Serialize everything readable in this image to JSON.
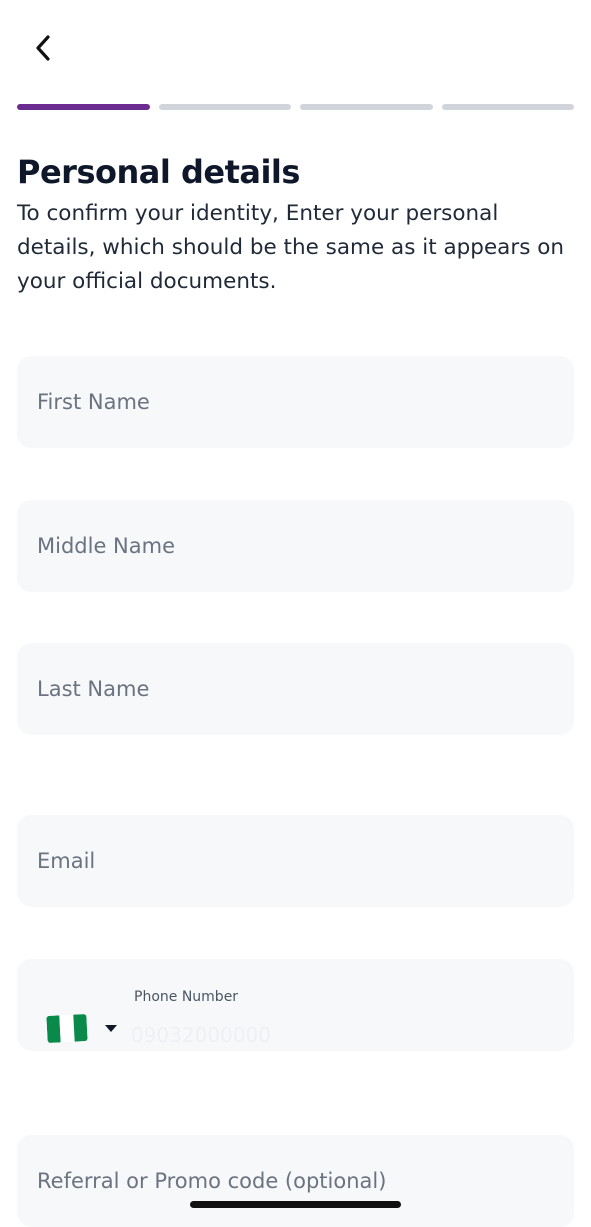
{
  "header": {
    "back_icon": "chevron-left-icon"
  },
  "progress": {
    "total_steps": 4,
    "current_step": 1,
    "active_color": "#6B2C91",
    "inactive_color": "#D1D5DB"
  },
  "page": {
    "title": "Personal details",
    "subtitle": "To confirm your identity, Enter your personal details, which should be the same as it appears on your official documents."
  },
  "form": {
    "first_name": {
      "placeholder": "First Name",
      "value": ""
    },
    "middle_name": {
      "placeholder": "Middle Name",
      "value": ""
    },
    "last_name": {
      "placeholder": "Last Name",
      "value": ""
    },
    "email": {
      "placeholder": "Email",
      "value": ""
    },
    "phone": {
      "label": "Phone Number",
      "placeholder": "09032000000",
      "value": "",
      "country_flag": "nigeria-flag-icon",
      "dropdown_icon": "caret-down-icon"
    },
    "referral": {
      "placeholder": "Referral or Promo code (optional)",
      "value": ""
    }
  }
}
